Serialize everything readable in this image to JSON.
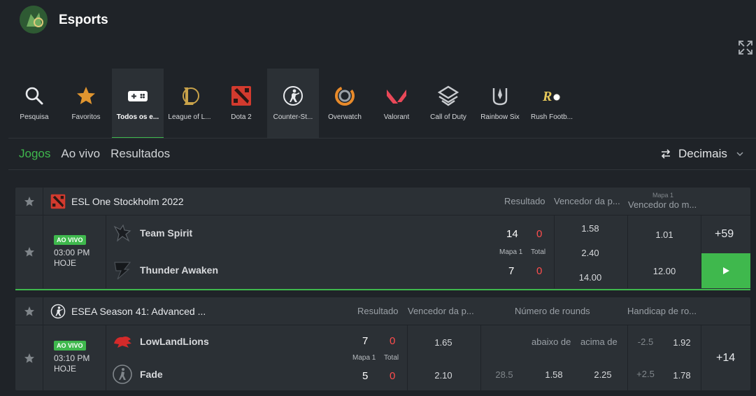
{
  "header": {
    "title": "Esports"
  },
  "categories": [
    {
      "name": "search",
      "label": "Pesquisa",
      "icon": "search-icon"
    },
    {
      "name": "favorites",
      "label": "Favoritos",
      "icon": "star-icon"
    },
    {
      "name": "all",
      "label": "Todos os e...",
      "icon": "gamepad-icon"
    },
    {
      "name": "lol",
      "label": "League of L...",
      "icon": "league-of-legends-icon"
    },
    {
      "name": "dota2",
      "label": "Dota 2",
      "icon": "dota2-icon"
    },
    {
      "name": "cs",
      "label": "Counter-St...",
      "icon": "counter-strike-icon"
    },
    {
      "name": "overwatch",
      "label": "Overwatch",
      "icon": "overwatch-icon"
    },
    {
      "name": "valorant",
      "label": "Valorant",
      "icon": "valorant-icon"
    },
    {
      "name": "cod",
      "label": "Call of Duty",
      "icon": "call-of-duty-icon"
    },
    {
      "name": "r6",
      "label": "Rainbow Six",
      "icon": "rainbow-six-icon"
    },
    {
      "name": "rush",
      "label": "Rush Footb...",
      "icon": "rush-football-icon"
    }
  ],
  "tabs": {
    "games": "Jogos",
    "live": "Ao vivo",
    "results": "Resultados"
  },
  "odds_format": {
    "label": "Decimais"
  },
  "events": [
    {
      "league": "ESL One Stockholm 2022",
      "headers": {
        "result": "Resultado",
        "winner": "Vencedor da p...",
        "map": "Mapa 1",
        "map_winner": "Vencedor do m..."
      },
      "status": "AO VIVO",
      "time": "03:00 PM",
      "day": "HOJE",
      "team1": {
        "name": "Team Spirit",
        "score": "14",
        "total": "0"
      },
      "team2": {
        "name": "Thunder Awaken",
        "score": "7",
        "total": "0"
      },
      "labels": {
        "map": "Mapa 1",
        "total": "Total"
      },
      "odds": {
        "w1": "1.58",
        "draw": "2.40",
        "w2": "14.00",
        "m1": "1.01",
        "m2": "12.00"
      },
      "more": "+59"
    },
    {
      "league": "ESEA Season 41: Advanced ...",
      "headers": {
        "result": "Resultado",
        "winner": "Vencedor da p...",
        "rounds": "Número de rounds",
        "handicap": "Handicap de ro..."
      },
      "status": "AO VIVO",
      "time": "03:10 PM",
      "day": "HOJE",
      "team1": {
        "name": "LowLandLions",
        "score": "7",
        "total": "0"
      },
      "team2": {
        "name": "Fade",
        "score": "5",
        "total": "0"
      },
      "labels": {
        "map": "Mapa 1",
        "total": "Total",
        "under": "abaixo de",
        "over": "acima de"
      },
      "odds": {
        "w1": "1.65",
        "w2": "2.10",
        "line": "28.5",
        "under": "1.58",
        "over": "2.25",
        "h1_line": "-2.5",
        "h1": "1.92",
        "h2_line": "+2.5",
        "h2": "1.78"
      },
      "more": "+14"
    }
  ]
}
